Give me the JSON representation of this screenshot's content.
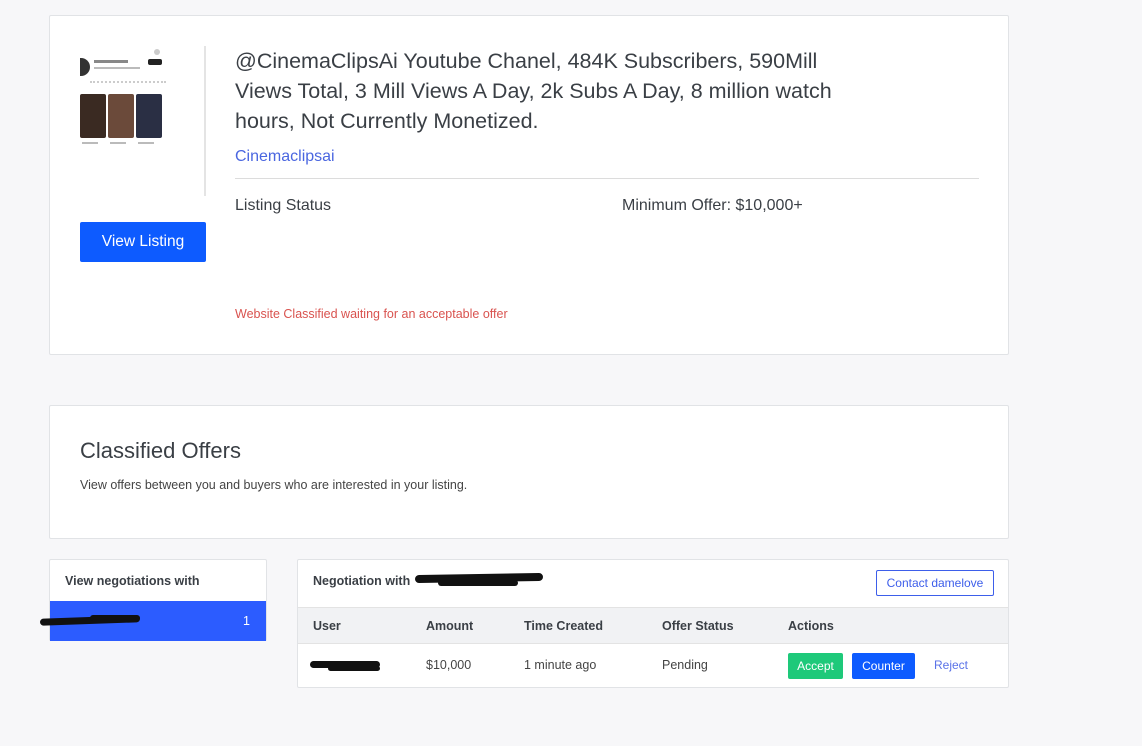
{
  "listing": {
    "title": "@CinemaClipsAi Youtube Chanel, 484K Subscribers, 590Mill Views Total, 3 Mill Views A Day, 2k Subs A Day, 8 million watch hours, Not Currently Monetized.",
    "channel_link": "Cinemaclipsai",
    "view_button": "View Listing",
    "status_label": "Listing Status",
    "min_offer": "Minimum Offer: $10,000+",
    "status_message": "Website Classified waiting for an acceptable offer"
  },
  "offers": {
    "title": "Classified Offers",
    "description": "View offers between you and buyers who are interested in your listing."
  },
  "sidebar": {
    "heading": "View negotiations with",
    "items": [
      {
        "count": "1"
      }
    ]
  },
  "negotiation": {
    "title": "Negotiation with",
    "contact_button": "Contact damelove",
    "columns": [
      "User",
      "Amount",
      "Time Created",
      "Offer Status",
      "Actions"
    ],
    "rows": [
      {
        "amount": "$10,000",
        "time_created": "1 minute ago",
        "status": "Pending"
      }
    ],
    "actions": {
      "accept": "Accept",
      "counter": "Counter",
      "reject": "Reject"
    }
  },
  "colors": {
    "primary": "#0d5bff",
    "accept": "#1ec97a",
    "status_message": "#d9534f",
    "link": "#4a66e0"
  }
}
